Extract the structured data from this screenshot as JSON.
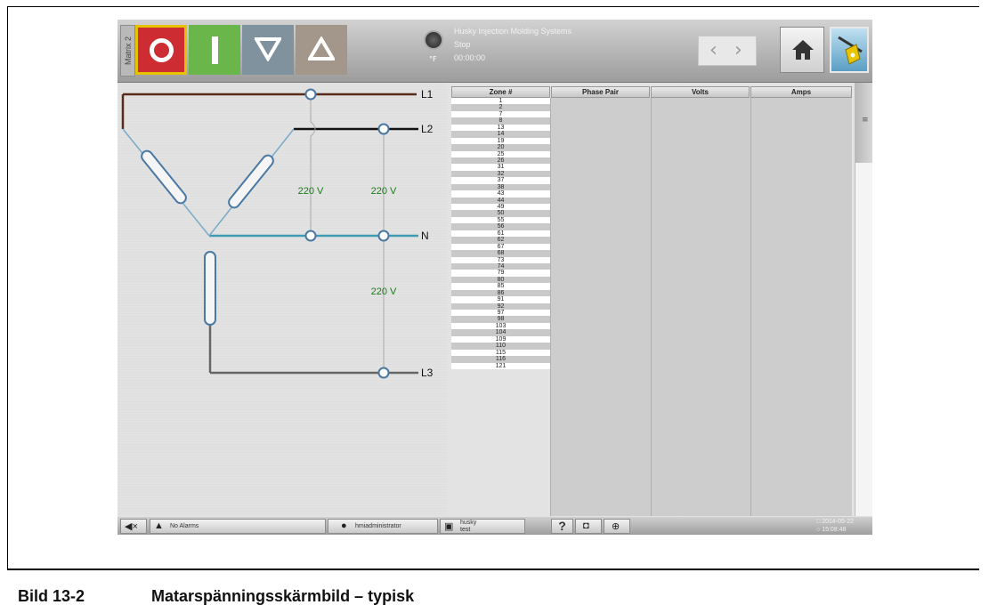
{
  "header": {
    "side_tab": "Matrix 2",
    "temp_unit": "°F",
    "status_lines": [
      "Husky Injection Molding Systems",
      "Stop",
      "00:00:00"
    ]
  },
  "diagram": {
    "lines": [
      "L1",
      "L2",
      "N",
      "L3"
    ],
    "voltages": [
      "220 V",
      "220 V",
      "220 V"
    ]
  },
  "table": {
    "columns": [
      "Zone #",
      "Phase Pair",
      "Volts",
      "Amps"
    ],
    "zones": [
      "1",
      "2",
      "7",
      "8",
      "13",
      "14",
      "19",
      "20",
      "25",
      "26",
      "31",
      "32",
      "37",
      "38",
      "43",
      "44",
      "49",
      "50",
      "55",
      "56",
      "61",
      "62",
      "67",
      "68",
      "73",
      "74",
      "79",
      "80",
      "85",
      "86",
      "91",
      "92",
      "97",
      "98",
      "103",
      "104",
      "109",
      "110",
      "115",
      "116",
      "121"
    ]
  },
  "footer": {
    "alarms": "No Alarms",
    "user": "hmiadministrator",
    "mold_line1": "husky",
    "mold_line2": "test",
    "help": "?",
    "date": "2014-05-22",
    "time": "15:08:48"
  },
  "caption": {
    "number": "Bild 13-2",
    "text": "Matarspänningsskärmbild – typisk"
  },
  "colors": {
    "stop": "#cd2d32",
    "start": "#6bb64b",
    "phase_brown": "#5a2a1a",
    "phase_black": "#111111",
    "neutral_teal": "#3f9ab4",
    "phase_grey": "#666666",
    "voltage_green": "#1a7a1a"
  }
}
